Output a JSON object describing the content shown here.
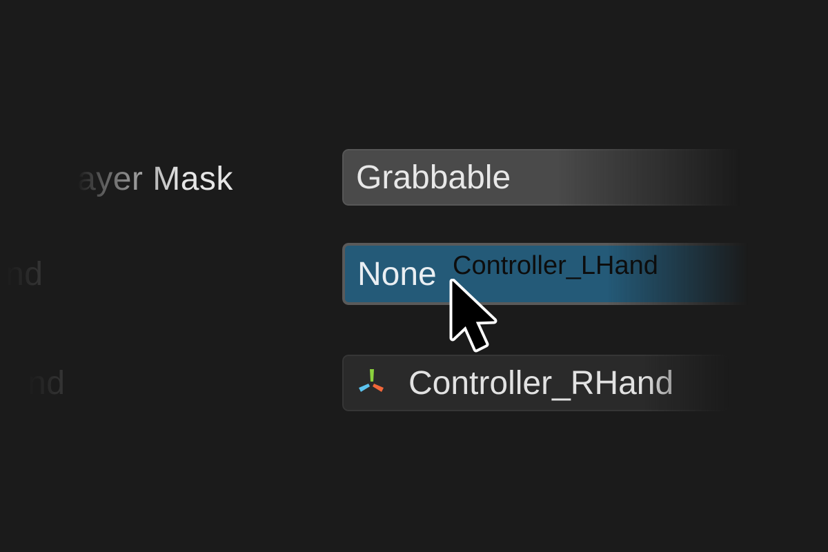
{
  "labels": {
    "layer_mask": "ayer Mask",
    "l_hand": "nd",
    "r_hand": "nd"
  },
  "fields": {
    "layer_mask_value": "Grabbable",
    "l_hand_value": "None",
    "r_hand_value": "Controller_RHand"
  },
  "drag": {
    "object_name": "Controller_LHand"
  },
  "icons": {
    "r_hand_icon": "rig-armature-icon",
    "cursor": "mouse-pointer-icon"
  },
  "colors": {
    "background": "#1b1b1b",
    "selected_field": "#245a78",
    "field": "#4a4a4a",
    "icon_green": "#8bd13d",
    "icon_blue": "#5cc3ee",
    "icon_orange": "#f2673a"
  }
}
